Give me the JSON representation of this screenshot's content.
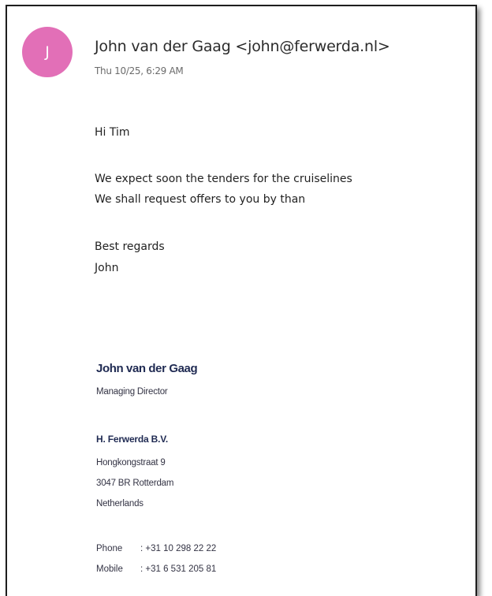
{
  "email": {
    "avatar_initial": "J",
    "avatar_color": "#e26fb7",
    "sender": "John van der Gaag <john@ferwerda.nl>",
    "datetime": "Thu 10/25, 6:29 AM",
    "body": {
      "greeting": "Hi Tim",
      "line1": "We expect soon the tenders for the cruiselines",
      "line2": "We shall request offers to you by than",
      "closing": "Best regards",
      "name": "John"
    }
  },
  "signature": {
    "name": "John van der Gaag",
    "title": "Managing Director",
    "company": "H. Ferwerda B.V.",
    "street": "Hongkongstraat 9",
    "city": "3047 BR  Rotterdam",
    "country": "Netherlands",
    "phone_label": "Phone",
    "phone_value": ": +31 10 298 22 22",
    "mobile_label": "Mobile",
    "mobile_value": ": +31 6 531 205 81"
  }
}
